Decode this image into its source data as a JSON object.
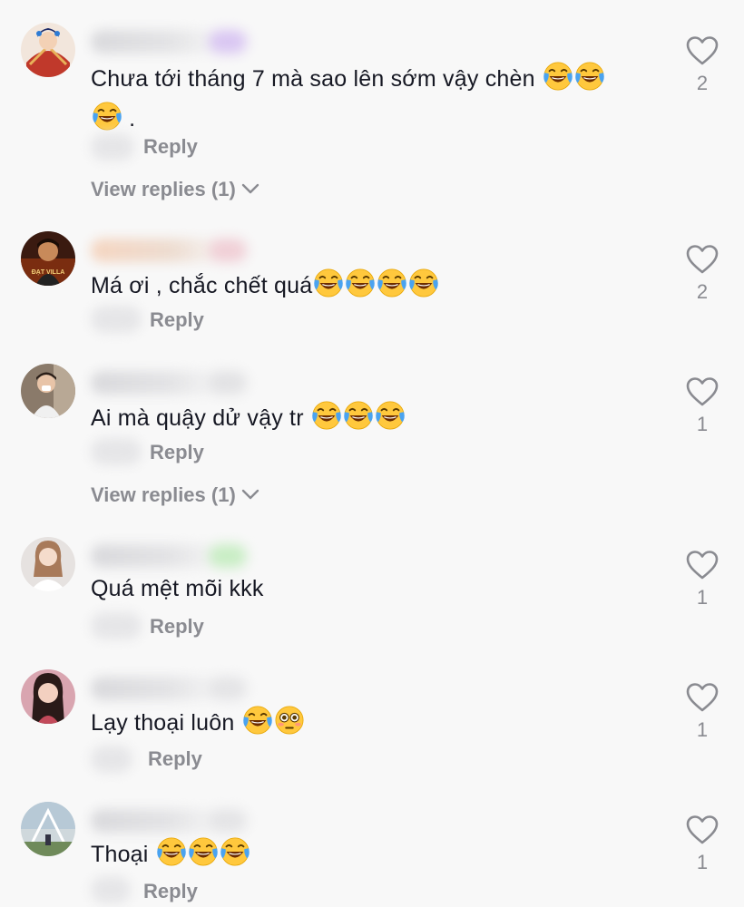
{
  "comments": [
    {
      "text": "Chưa tới tháng 7 mà sao lên sớm vậy chèn",
      "emojis": [
        "face-with-tears-of-joy",
        "face-with-tears-of-joy"
      ],
      "continuation_emoji": "face-with-tears-of-joy",
      "continuation_text": ".",
      "reply_label": "Reply",
      "view_replies_label": "View replies (1)",
      "like_count": "2"
    },
    {
      "text": "Má ơi , chắc chết quá",
      "emojis": [
        "face-with-tears-of-joy",
        "face-with-tears-of-joy",
        "face-with-tears-of-joy",
        "face-with-tears-of-joy"
      ],
      "reply_label": "Reply",
      "like_count": "2",
      "avatar_caption": "ĐẠT VILLA"
    },
    {
      "text": "Ai mà quậy dử vậy tr",
      "emojis": [
        "face-with-tears-of-joy",
        "face-with-tears-of-joy",
        "face-with-tears-of-joy"
      ],
      "reply_label": "Reply",
      "view_replies_label": "View replies (1)",
      "like_count": "1"
    },
    {
      "text": "Quá mệt mõi kkk",
      "emojis": [],
      "reply_label": "Reply",
      "like_count": "1"
    },
    {
      "text": "Lạy thoại luôn",
      "emojis": [
        "face-with-tears-of-joy",
        "flushed-face"
      ],
      "reply_label": "Reply",
      "like_count": "1"
    },
    {
      "text": "Thoại",
      "emojis": [
        "face-with-tears-of-joy",
        "face-with-tears-of-joy",
        "face-with-tears-of-joy"
      ],
      "reply_label": "Reply",
      "like_count": "1"
    }
  ],
  "icons": {
    "like": "heart-outline-icon",
    "chevron": "chevron-down-icon"
  },
  "colors": {
    "background": "#f8f8f8",
    "text": "#161823",
    "secondary": "#8a8b91",
    "emoji_yellow": "#ffc83d",
    "emoji_tear": "#4aa3f0"
  }
}
